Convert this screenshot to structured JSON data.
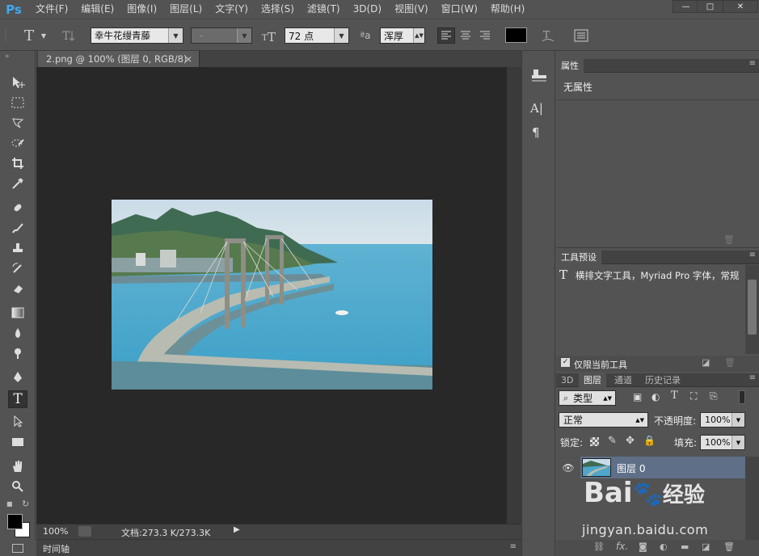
{
  "app": {
    "logo": "Ps"
  },
  "menu": [
    "文件(F)",
    "编辑(E)",
    "图像(I)",
    "图层(L)",
    "文字(Y)",
    "选择(S)",
    "滤镜(T)",
    "3D(D)",
    "视图(V)",
    "窗口(W)",
    "帮助(H)"
  ],
  "window_buttons": [
    "—",
    "□",
    "✕"
  ],
  "options": {
    "tool_glyph": "T",
    "font_family": "幸牛花缦青藤",
    "font_style": "-",
    "font_size": "72 点",
    "aa_label": "ªa",
    "antialias": "浑厚",
    "text_color": "#000000"
  },
  "document": {
    "tab_title": "2.png @ 100% (图层 0, RGB/8)",
    "zoom": "100%",
    "doc_info": "文档:273.3 K/273.3K"
  },
  "timeline": {
    "label": "时间轴"
  },
  "properties": {
    "title": "属性",
    "content": "无属性"
  },
  "tool_presets": {
    "title": "工具预设",
    "item": "横排文字工具，Myriad Pro 字体，常规",
    "checkbox_label": "仅限当前工具"
  },
  "layers_panel": {
    "tabs": [
      "3D",
      "图层",
      "通道",
      "历史记录"
    ],
    "filter_kind": "类型",
    "blend_mode": "正常",
    "opacity_label": "不透明度:",
    "opacity_value": "100%",
    "lock_label": "锁定:",
    "fill_label": "填充:",
    "fill_value": "100%",
    "layers": [
      {
        "name": "图层 0"
      }
    ]
  },
  "watermark": {
    "brand": "Bai",
    "brand2": "经验",
    "url": "jingyan.baidu.com"
  },
  "colors": {
    "ps_blue": "#3fa9f5",
    "canvas_bg": "#282828",
    "ui_bg": "#535353",
    "selected_layer": "#5e6f87"
  }
}
